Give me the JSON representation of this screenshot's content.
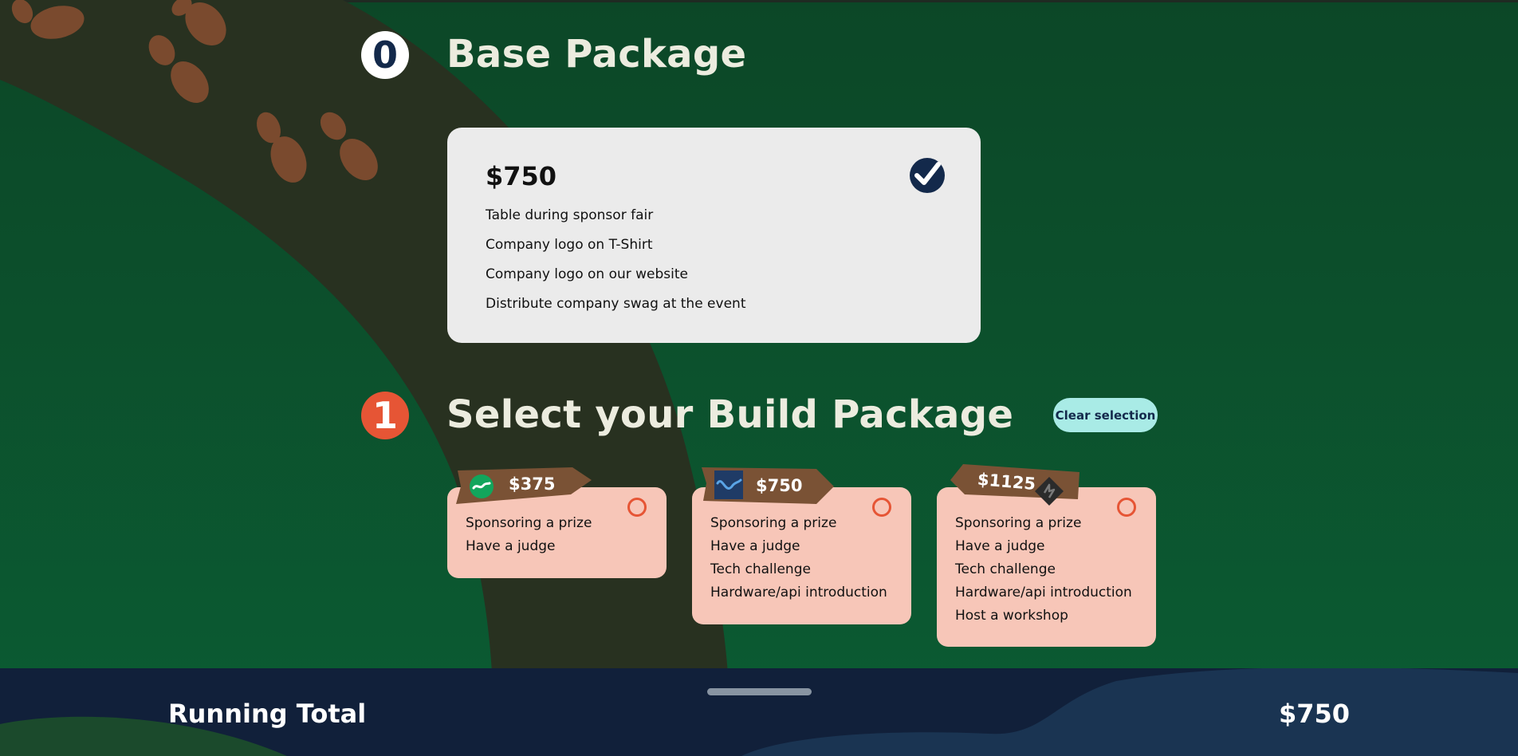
{
  "base": {
    "number": "0",
    "title": "Base Package",
    "price": "$750",
    "features": [
      "Table during sponsor fair",
      "Company logo on T-Shirt",
      "Company logo on our website",
      "Distribute company swag at the event"
    ],
    "selected": true
  },
  "build": {
    "number": "1",
    "title": "Select your Build Package",
    "clear_label": "Clear selection",
    "packages": [
      {
        "price": "$375",
        "icon": "green-wave-badge-icon",
        "selected": false,
        "features": [
          "Sponsoring a prize",
          "Have a judge"
        ]
      },
      {
        "price": "$750",
        "icon": "blue-wave-square-icon",
        "selected": false,
        "features": [
          "Sponsoring a prize",
          "Have a judge",
          "Tech challenge",
          "Hardware/api introduction"
        ]
      },
      {
        "price": "$1125",
        "icon": "dark-lightning-diamond-icon",
        "selected": false,
        "features": [
          "Sponsoring a prize",
          "Have a judge",
          "Tech challenge",
          "Hardware/api introduction",
          "Host a workshop"
        ]
      }
    ]
  },
  "footer": {
    "label": "Running Total",
    "total": "$750"
  },
  "colors": {
    "background": "#0d4d2b",
    "path": "#283120",
    "footprint": "#7a4a2e",
    "card": "#ebebeb",
    "package_card": "#f7c6b8",
    "accent_red": "#e65535",
    "navy": "#13294b",
    "clear_button": "#a9ebe6",
    "sign_wood": "#7a5235"
  }
}
